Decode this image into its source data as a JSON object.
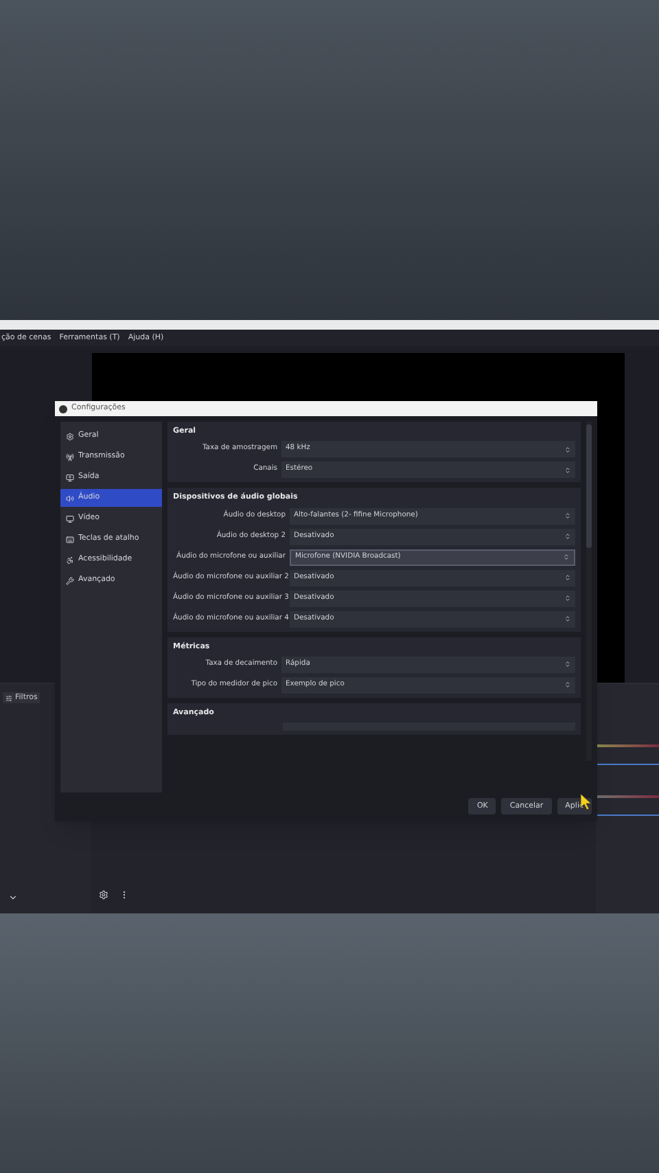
{
  "menu_bar": [
    "ção de cenas",
    "Ferramentas (T)",
    "Ajuda (H)"
  ],
  "dialog": {
    "title": "Configurações",
    "sidebar": [
      {
        "label": "Geral",
        "selected": false
      },
      {
        "label": "Transmissão",
        "selected": false
      },
      {
        "label": "Saída",
        "selected": false
      },
      {
        "label": "Áudio",
        "selected": true
      },
      {
        "label": "Vídeo",
        "selected": false
      },
      {
        "label": "Teclas de atalho",
        "selected": false
      },
      {
        "label": "Acessibilidade",
        "selected": false
      },
      {
        "label": "Avançado",
        "selected": false
      }
    ],
    "sections": [
      {
        "title": "Geral",
        "rows": [
          {
            "label": "Taxa de amostragem",
            "value": "48 kHz",
            "focused": false
          },
          {
            "label": "Canais",
            "value": "Estéreo",
            "focused": false
          }
        ]
      },
      {
        "title": "Dispositivos de áudio globais",
        "rows": [
          {
            "label": "Áudio do desktop",
            "value": "Alto-falantes (2- fifine Microphone)",
            "focused": false
          },
          {
            "label": "Áudio do desktop 2",
            "value": "Desativado",
            "focused": false
          },
          {
            "label": "Áudio do microfone ou auxiliar",
            "value": "Microfone (NVIDIA Broadcast)",
            "focused": true
          },
          {
            "label": "Áudio do microfone ou auxiliar 2",
            "value": "Desativado",
            "focused": false
          },
          {
            "label": "Áudio do microfone ou auxiliar 3",
            "value": "Desativado",
            "focused": false
          },
          {
            "label": "Áudio do microfone ou auxiliar 4",
            "value": "Desativado",
            "focused": false
          }
        ]
      },
      {
        "title": "Métricas",
        "rows": [
          {
            "label": "Taxa de decaimento",
            "value": "Rápida",
            "focused": false
          },
          {
            "label": "Tipo do medidor de pico",
            "value": "Exemplo de pico",
            "focused": false
          }
        ]
      },
      {
        "title": "Avançado"
      }
    ],
    "buttons": [
      "OK",
      "Cancelar",
      "Aplic"
    ]
  },
  "dock": {
    "filters_button": "Filtros"
  }
}
